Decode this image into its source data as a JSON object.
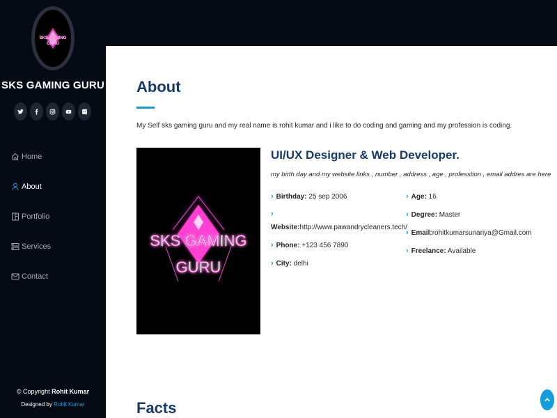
{
  "sidebar": {
    "logo_text": "SKS GAMING GURU",
    "site_name": "SKS GAMING GURU",
    "social": [
      {
        "icon": "twitter-icon",
        "glyph": "🐦"
      },
      {
        "icon": "facebook-icon",
        "glyph": "f"
      },
      {
        "icon": "instagram-icon",
        "glyph": "◎"
      },
      {
        "icon": "youtube-icon",
        "glyph": "▶"
      },
      {
        "icon": "discord-icon",
        "glyph": "◙"
      }
    ],
    "nav": [
      {
        "label": "Home",
        "icon": "home-icon",
        "active": false
      },
      {
        "label": "About",
        "icon": "person-icon",
        "active": true
      },
      {
        "label": "Portfolio",
        "icon": "portfolio-icon",
        "active": false
      },
      {
        "label": "Services",
        "icon": "server-icon",
        "active": false
      },
      {
        "label": "Contact",
        "icon": "envelope-icon",
        "active": false
      }
    ],
    "copyright_prefix": "© Copyright ",
    "copyright_name": "Rohit Kumar",
    "credits_prefix": "Designed by ",
    "credits_name": "Rohit Kumar"
  },
  "about": {
    "title": "About",
    "intro": "My Self sks gaming guru and my real name is rohit kumar and i like to do coding and gaming and my profession is coding.",
    "image_text_line1": "SKS GAMING",
    "image_text_line2": "GURU",
    "role": "UI/UX Designer & Web Developer.",
    "role_sub": "my birth day and my website links , number , address , age , professtion , email addres are here",
    "left_info": [
      {
        "label": "Birthday:",
        "value": " 25 sep 2006"
      },
      {
        "label": "Website:",
        "value": "http://www.pawandrycleaners.tech/"
      },
      {
        "label": "Phone:",
        "value": " +123 456 7890"
      },
      {
        "label": "City:",
        "value": " delhi"
      }
    ],
    "right_info": [
      {
        "label": "Age:",
        "value": " 16"
      },
      {
        "label": "Degree:",
        "value": " Master"
      },
      {
        "label": "Email:",
        "value": "rohitkumarsunariya@Gmail.com"
      },
      {
        "label": "Freelance:",
        "value": " Available"
      }
    ]
  },
  "facts": {
    "title": "Facts"
  },
  "colors": {
    "sidebar_bg": "#040b14",
    "accent": "#149ddd",
    "heading": "#173b6c",
    "neon_pink": "#ff4fd8"
  }
}
